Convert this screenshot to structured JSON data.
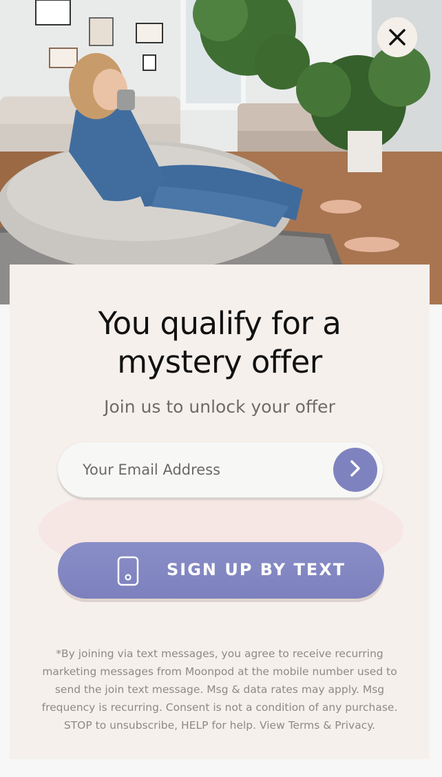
{
  "modal": {
    "headline_line1": "You qualify for a",
    "headline_line2": "mystery offer",
    "subheadline": "Join us to unlock your offer",
    "email": {
      "placeholder": "Your Email Address",
      "value": ""
    },
    "sms_button_label": "SIGN UP BY TEXT",
    "disclaimer": "*By joining via text messages, you agree to receive recurring marketing messages from Moonpod at the mobile number used to send the join text message. Msg & data rates may apply. Msg frequency is recurring. Consent is not a condition of any purchase. STOP to unsubscribe, HELP for help. View Terms & Privacy."
  },
  "icons": {
    "close": "close-icon",
    "submit": "chevron-right-icon",
    "phone": "phone-icon"
  },
  "colors": {
    "accent": "#7e83bf",
    "card_background": "#f6f0ec",
    "close_background": "#f5efea"
  }
}
